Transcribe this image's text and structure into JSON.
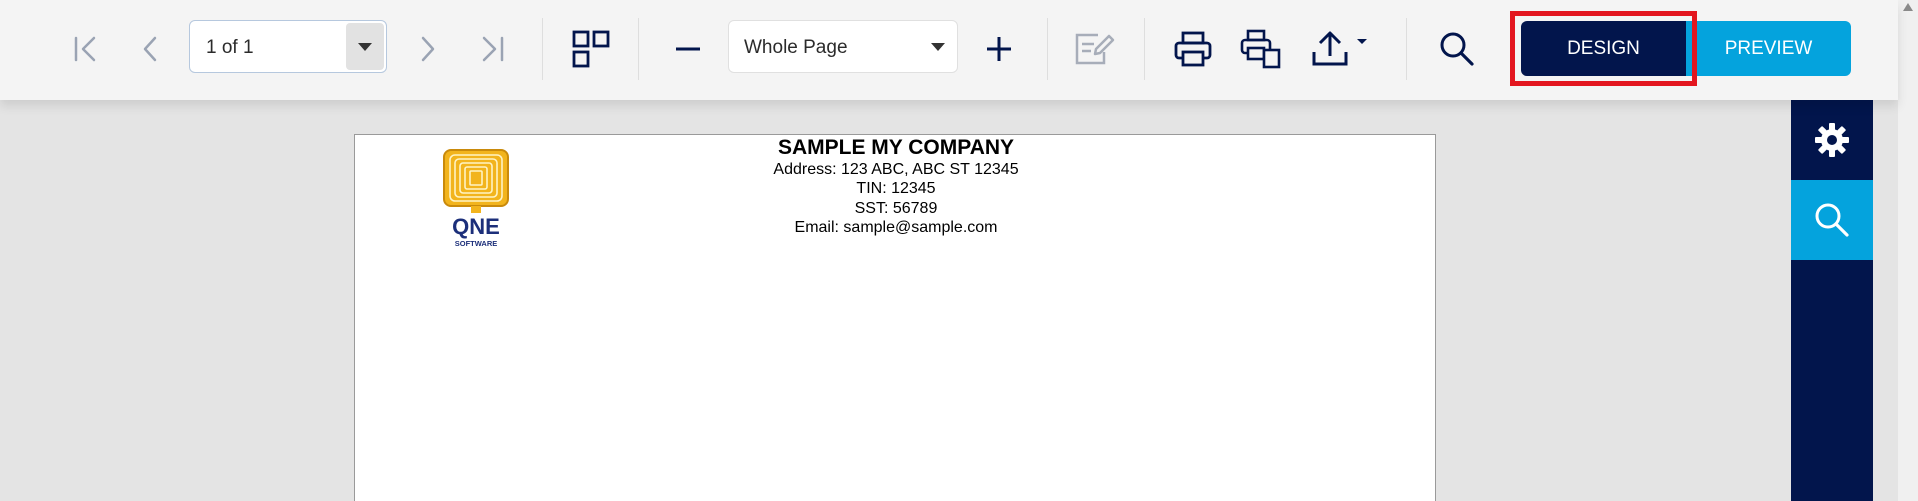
{
  "toolbar": {
    "page_selector": {
      "value": "1 of 1"
    },
    "zoom_selector": {
      "value": "Whole Page"
    },
    "design_label": "DESIGN",
    "preview_label": "PREVIEW",
    "icons": [
      "first-page-icon",
      "previous-page-icon",
      "next-page-icon",
      "last-page-icon",
      "multipage-icon",
      "zoom-out-icon",
      "zoom-in-icon",
      "edit-icon",
      "print-icon",
      "print-page-icon",
      "export-icon",
      "search-icon"
    ]
  },
  "sidepanel": {
    "items": [
      {
        "icon": "gear-icon",
        "active": false
      },
      {
        "icon": "search-icon",
        "active": true
      }
    ]
  },
  "document": {
    "company_name": "SAMPLE MY COMPANY",
    "address": "Address: 123 ABC, ABC ST 12345",
    "tin": "TIN: 12345",
    "sst": "SST: 56789",
    "email": "Email: sample@sample.com",
    "logo_text": "QNE",
    "logo_subtext": "SOFTWARE"
  },
  "colors": {
    "navy": "#02154c",
    "accent_blue": "#04a3dd",
    "highlight_red": "#e3161f",
    "logo_gold": "#e6a817"
  }
}
